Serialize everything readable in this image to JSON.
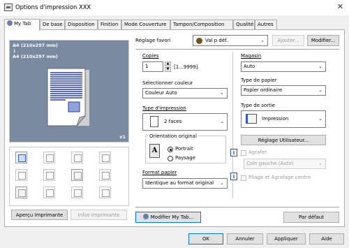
{
  "window": {
    "title": "Options d'impression XXX",
    "close_glyph": "✕"
  },
  "tabs": [
    {
      "label": "My Tab",
      "active": true
    },
    {
      "label": "De base"
    },
    {
      "label": "Disposition"
    },
    {
      "label": "Finition"
    },
    {
      "label": "Mode Couverture"
    },
    {
      "label": "Tampon/Composition"
    },
    {
      "label": "Qualité"
    },
    {
      "label": "Autres"
    }
  ],
  "preview": {
    "size_line1": "A4 (210x297 mm)",
    "arrow": "↓",
    "size_line2": "A4 (210x297 mm)",
    "copies_badge": "x1"
  },
  "left_buttons": {
    "apercu": "Aperçu Imprimante",
    "infos": "Infos imprimante"
  },
  "favorite": {
    "label": "Réglage favori",
    "value": "Val p déf.",
    "ajouter": "Ajouter...",
    "modifier": "Modifier..."
  },
  "copies": {
    "label": "Copies",
    "value": "1",
    "range": "[1...9999]"
  },
  "color": {
    "label": "Sélectionner couleur",
    "value": "Couleur Auto"
  },
  "print_type": {
    "label": "Type d'impression",
    "value": "2 faces"
  },
  "orientation": {
    "label": "Orientation original",
    "portrait": "Portrait",
    "paysage": "Paysage",
    "selected": "Portrait"
  },
  "paper_format": {
    "label": "Format papier",
    "value": "Identique au format original"
  },
  "magasin": {
    "label": "Magasin",
    "value": "Auto"
  },
  "paper_type": {
    "label": "Type de papier",
    "value": "Papier ordinaire"
  },
  "output_type": {
    "label": "Type de sortie",
    "value": "Impression"
  },
  "user_setting_button": "Réglage Utilisateur...",
  "agrafer": {
    "label": "Agrafer",
    "value": "Coin gauche (Auto)"
  },
  "pliage": {
    "label": "Pliage et Agrafage centre"
  },
  "modifier_mytab": "Modifier My Tab...",
  "par_defaut": "Par défaut",
  "footer": {
    "ok": "OK",
    "annuler": "Annuler",
    "appliquer": "Appliquer",
    "aide": "Aide"
  },
  "colors": {
    "accent": "#0078d7",
    "preview_bg": "#7a8aa0",
    "page_lines": "#2a3f9e"
  }
}
